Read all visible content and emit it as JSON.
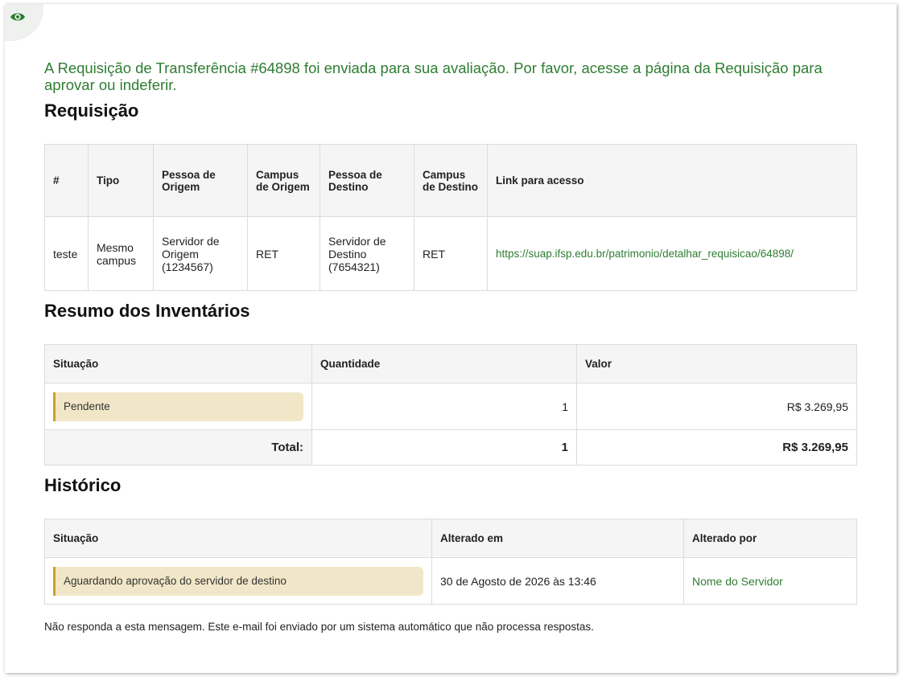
{
  "intro_text": "A Requisição de Transferência #64898 foi enviada para sua avaliação. Por favor, acesse a página da Requisição para aprovar ou indeferir.",
  "requisicao": {
    "title": "Requisição",
    "headers": [
      "#",
      "Tipo",
      "Pessoa de Origem",
      "Campus de Origem",
      "Pessoa de Destino",
      "Campus de Destino",
      "Link para acesso"
    ],
    "row": {
      "id": "teste",
      "tipo": "Mesmo campus",
      "pessoa_origem": "Servidor de Origem (1234567)",
      "campus_origem": "RET",
      "pessoa_destino": "Servidor de Destino (7654321)",
      "campus_destino": "RET",
      "link": "https://suap.ifsp.edu.br/patrimonio/detalhar_requisicao/64898/"
    }
  },
  "resumo": {
    "title": "Resumo dos Inventários",
    "headers": [
      "Situação",
      "Quantidade",
      "Valor"
    ],
    "row": {
      "situacao": "Pendente",
      "quantidade": "1",
      "valor": "R$ 3.269,95"
    },
    "total": {
      "label": "Total:",
      "quantidade": "1",
      "valor": "R$ 3.269,95"
    }
  },
  "historico": {
    "title": "Histórico",
    "headers": [
      "Situação",
      "Alterado em",
      "Alterado por"
    ],
    "row": {
      "situacao": "Aguardando aprovação do servidor de destino",
      "alterado_em": "30 de Agosto de 2026 às 13:46",
      "alterado_por": "Nome do Servidor"
    }
  },
  "footer_note": "Não responda a esta mensagem. Este e-mail foi enviado por um sistema automático que não processa respostas.",
  "colors": {
    "accent_green": "#2e7d32",
    "pending_bg": "#f1e7c8",
    "pending_border": "#c9a227"
  },
  "icons": {
    "badge": "eye-icon"
  }
}
